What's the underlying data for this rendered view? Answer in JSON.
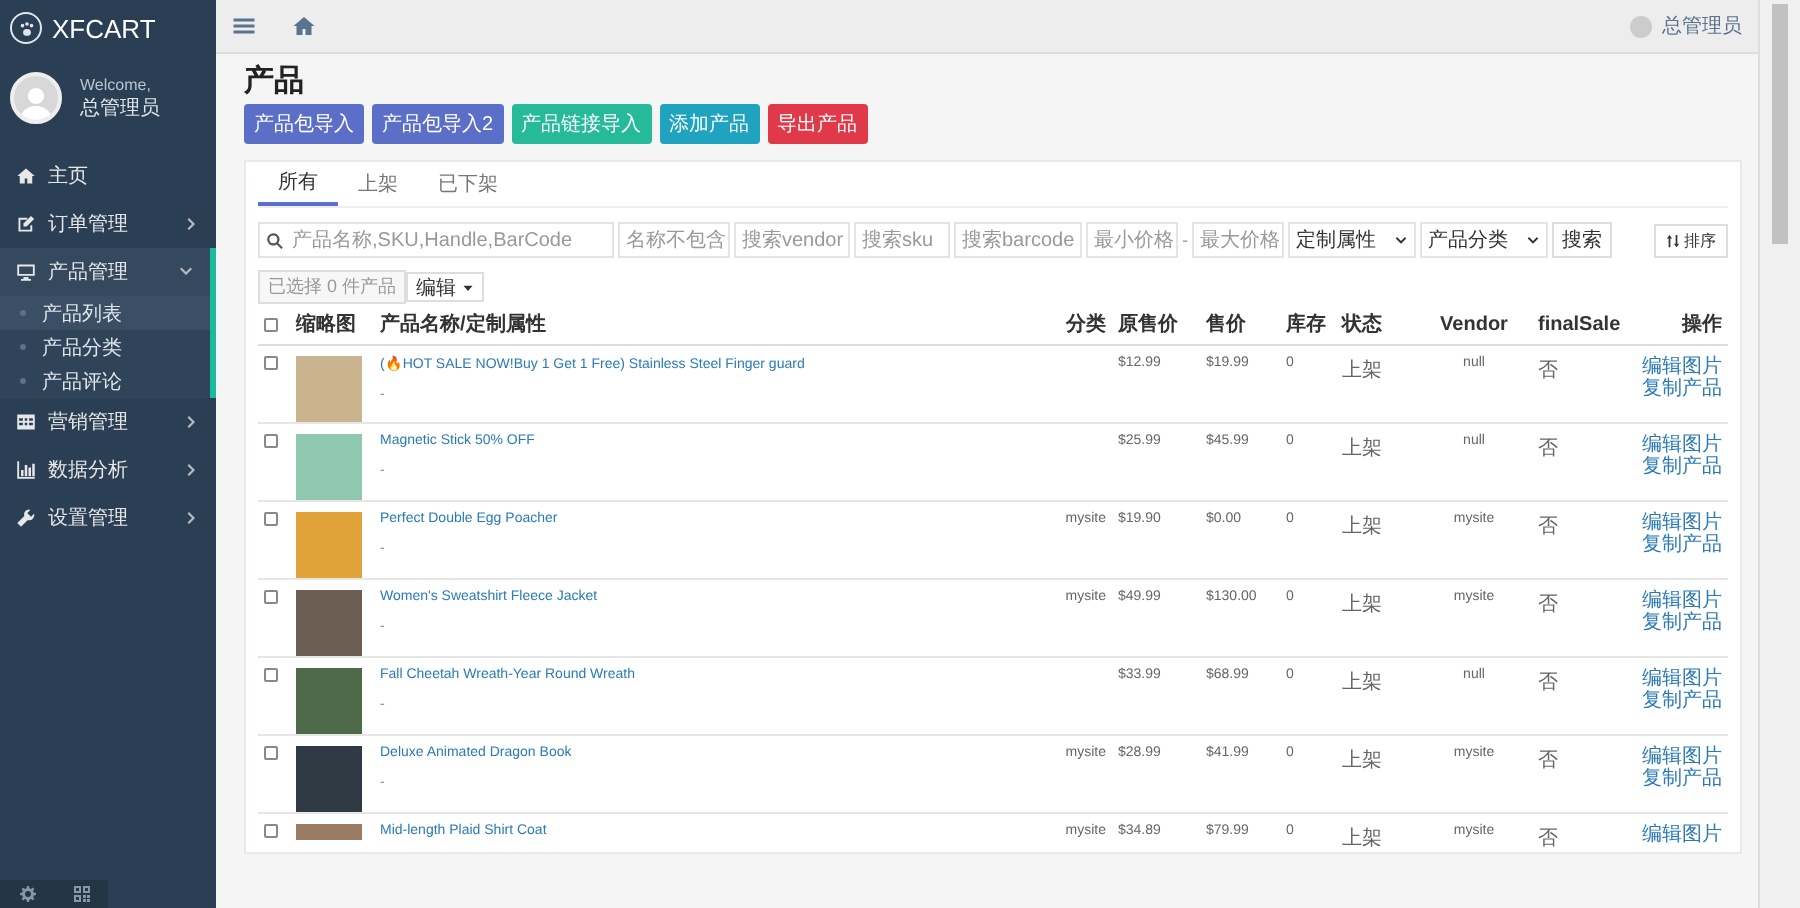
{
  "brand": {
    "name": "XFCART"
  },
  "user": {
    "welcome": "Welcome,",
    "name": "总管理员"
  },
  "sidebar": {
    "items": [
      {
        "label": "主页",
        "kind": "link",
        "selected": false
      },
      {
        "label": "订单管理",
        "kind": "group",
        "expanded": false,
        "selected": false
      },
      {
        "label": "产品管理",
        "kind": "group",
        "expanded": true,
        "selected": true,
        "children": [
          {
            "label": "产品列表",
            "selected": true
          },
          {
            "label": "产品分类",
            "selected": false
          },
          {
            "label": "产品评论",
            "selected": false
          }
        ]
      },
      {
        "label": "营销管理",
        "kind": "group",
        "expanded": false,
        "selected": false
      },
      {
        "label": "数据分析",
        "kind": "group",
        "expanded": false,
        "selected": false
      },
      {
        "label": "设置管理",
        "kind": "group",
        "expanded": false,
        "selected": false
      }
    ]
  },
  "topbar": {
    "user_name": "总管理员"
  },
  "page": {
    "title": "产品",
    "buttons": [
      {
        "label": "产品包导入",
        "color": "#5b6fc9"
      },
      {
        "label": "产品包导入2",
        "color": "#5b6fc9"
      },
      {
        "label": "产品链接导入",
        "color": "#26b99a"
      },
      {
        "label": "添加产品",
        "color": "#1fa3bf"
      },
      {
        "label": "导出产品",
        "color": "#e03a4a"
      }
    ]
  },
  "tabs": [
    {
      "label": "所有",
      "selected": true
    },
    {
      "label": "上架",
      "selected": false
    },
    {
      "label": "已下架",
      "selected": false
    }
  ],
  "filters": {
    "search": {
      "placeholder": "产品名称,SKU,Handle,BarCode"
    },
    "exclude": {
      "placeholder": "名称不包含"
    },
    "vendor": {
      "placeholder": "搜索vendor"
    },
    "sku": {
      "placeholder": "搜索sku"
    },
    "barcode": {
      "placeholder": "搜索barcode"
    },
    "min_price": {
      "placeholder": "最小价格"
    },
    "range_sep": "-",
    "max_price": {
      "placeholder": "最大价格"
    },
    "selects": [
      "定制属性",
      "产品分类"
    ],
    "search_button": "搜索",
    "sort_button": "排序"
  },
  "selection": {
    "count_label": "已选择 0 件产品",
    "edit_menu": "编辑"
  },
  "table": {
    "select_all_checked": false,
    "columns": [
      "缩略图",
      "产品名称/定制属性",
      "分类",
      "原售价",
      "售价",
      "库存",
      "状态",
      "Vendor",
      "finalSale",
      "操作"
    ],
    "rows": [
      {
        "checked": false,
        "name": "(🔥HOT SALE NOW!Buy 1 Get 1 Free) Stainless Steel Finger guard",
        "sub": "-",
        "category": "",
        "original_price": "$12.99",
        "price": "$19.99",
        "stock": "0",
        "status": "上架",
        "vendor": "null",
        "final_sale": "否",
        "actions": [
          "编辑图片",
          "复制产品"
        ]
      },
      {
        "checked": false,
        "name": "Magnetic Stick 50% OFF",
        "sub": "-",
        "category": "",
        "original_price": "$25.99",
        "price": "$45.99",
        "stock": "0",
        "status": "上架",
        "vendor": "null",
        "final_sale": "否",
        "actions": [
          "编辑图片",
          "复制产品"
        ]
      },
      {
        "checked": false,
        "name": "Perfect Double Egg Poacher",
        "sub": "-",
        "category": "mysite",
        "original_price": "$19.90",
        "price": "$0.00",
        "stock": "0",
        "status": "上架",
        "vendor": "mysite",
        "final_sale": "否",
        "actions": [
          "编辑图片",
          "复制产品"
        ]
      },
      {
        "checked": false,
        "name": "Women's Sweatshirt Fleece Jacket",
        "sub": "-",
        "category": "mysite",
        "original_price": "$49.99",
        "price": "$130.00",
        "stock": "0",
        "status": "上架",
        "vendor": "mysite",
        "final_sale": "否",
        "actions": [
          "编辑图片",
          "复制产品"
        ]
      },
      {
        "checked": false,
        "name": "Fall Cheetah Wreath-Year Round Wreath",
        "sub": "-",
        "category": "",
        "original_price": "$33.99",
        "price": "$68.99",
        "stock": "0",
        "status": "上架",
        "vendor": "null",
        "final_sale": "否",
        "actions": [
          "编辑图片",
          "复制产品"
        ]
      },
      {
        "checked": false,
        "name": "Deluxe Animated Dragon Book",
        "sub": "-",
        "category": "mysite",
        "original_price": "$28.99",
        "price": "$41.99",
        "stock": "0",
        "status": "上架",
        "vendor": "mysite",
        "final_sale": "否",
        "actions": [
          "编辑图片",
          "复制产品"
        ]
      },
      {
        "checked": false,
        "name": "Mid-length Plaid Shirt Coat",
        "category": "mysite",
        "original_price": "$34.89",
        "price": "$79.99",
        "stock": "0",
        "status": "上架",
        "vendor": "mysite",
        "final_sale": "否",
        "actions": [
          "编辑图片"
        ]
      }
    ]
  }
}
